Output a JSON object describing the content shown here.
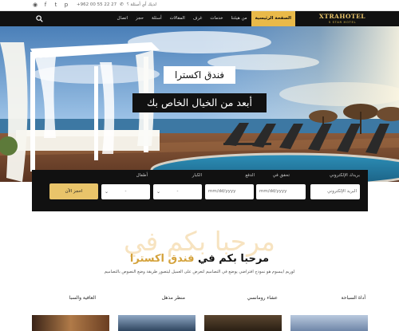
{
  "topbar": {
    "social_icons": [
      "instagram-icon",
      "facebook-icon",
      "twitter-icon",
      "pinterest-icon"
    ],
    "phone": "+962 00 55 22 27",
    "question": "لديك أي أسئلة ؟"
  },
  "nav": {
    "logo_title": "XTRAHOTEL",
    "logo_subtitle": "5 STAR HOTEL",
    "menu": [
      {
        "label": "الصفحة الرئيسية",
        "active": true
      },
      {
        "label": "من هيئتنا"
      },
      {
        "label": "خدمات"
      },
      {
        "label": "غرف"
      },
      {
        "label": "المقالات"
      },
      {
        "label": "أسئلة"
      },
      {
        "label": "حجز"
      },
      {
        "label": "اتصال"
      }
    ]
  },
  "hero": {
    "title": "فندق اكسترا",
    "subtitle": "أبعد من الخيال الخاص بك"
  },
  "booking": {
    "email_label": "بريدك الإلكتروني",
    "email_placeholder": "البريد الإلكتروني",
    "checkin_label": "تحقق في",
    "checkin_value": "mm/dd/yyyy",
    "checkout_label": "الدفع",
    "checkout_value": "mm/dd/yyyy",
    "adults_label": "الكبار",
    "adults_value": "-",
    "children_label": "أطفال",
    "children_value": "-",
    "submit_label": "احجز الآن"
  },
  "welcome": {
    "watermark": "مرحبا بكم في",
    "prefix": "مرحبا بكم في",
    "highlight": "فندق اكسترا",
    "description": "لوريم ايبسوم هو نموذج افتراضي يوضع في التصاميم لتعرض على العميل ليتصور طريقة وضع النصوص بالتصاميم"
  },
  "features": [
    "أداة السباحة",
    "عشاء رومانسي",
    "منظر مذهل",
    "العافية والسبا"
  ],
  "colors": {
    "accent": "#e9c46a",
    "dark": "#111111"
  }
}
